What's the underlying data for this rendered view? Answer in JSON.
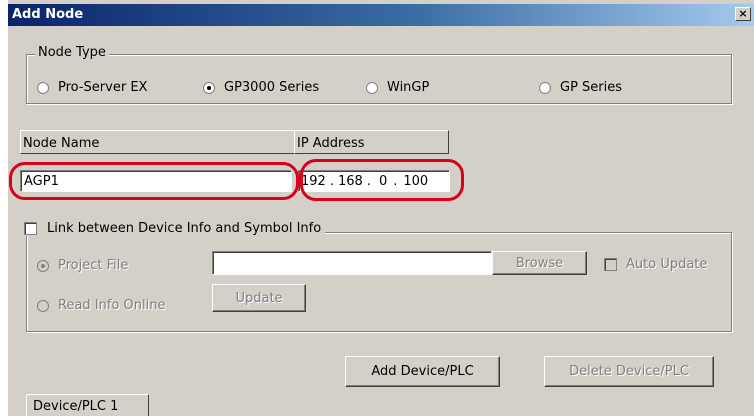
{
  "window": {
    "title": "Add Node",
    "close_glyph": "×"
  },
  "node_type": {
    "legend": "Node Type",
    "options": [
      {
        "label": "Pro-Server EX",
        "checked": false
      },
      {
        "label": "GP3000 Series",
        "checked": true
      },
      {
        "label": "WinGP",
        "checked": false
      },
      {
        "label": "GP Series",
        "checked": false
      }
    ]
  },
  "node_name": {
    "header": "Node Name",
    "value": "AGP1"
  },
  "ip_address": {
    "header": "IP Address",
    "octets": [
      "192",
      "168",
      "0",
      "100"
    ],
    "separator": "."
  },
  "link_group": {
    "checkbox_label": "Link between Device Info and Symbol Info",
    "checked": false,
    "project_file": {
      "label": "Project File",
      "checked": true,
      "value": ""
    },
    "browse_label": "Browse",
    "auto_update_label": "Auto Update",
    "read_info_online": {
      "label": "Read Info Online",
      "checked": false
    },
    "update_label": "Update"
  },
  "buttons": {
    "add_device": "Add Device/PLC",
    "delete_device": "Delete Device/PLC"
  },
  "tabs": [
    {
      "label": "Device/PLC 1"
    }
  ],
  "colors": {
    "highlight": "#d9001b",
    "titlebar": "#0a246a",
    "face": "#d4d0c8"
  }
}
